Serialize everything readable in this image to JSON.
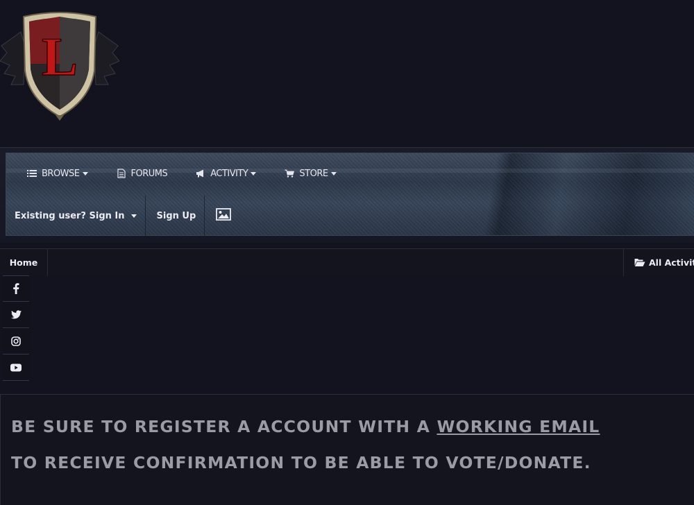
{
  "brand": {
    "logo_letter": "L"
  },
  "primary_nav": {
    "items": [
      {
        "label": "Browse",
        "icon": "list-icon",
        "has_dropdown": true
      },
      {
        "label": "Forums",
        "icon": "document-icon",
        "has_dropdown": false
      },
      {
        "label": "Activity",
        "icon": "bullhorn-icon",
        "has_dropdown": true
      },
      {
        "label": "Store",
        "icon": "cart-icon",
        "has_dropdown": true
      }
    ]
  },
  "user_nav": {
    "sign_in_label": "Existing user? Sign In",
    "sign_up_label": "Sign Up",
    "image_icon": "image-icon"
  },
  "breadcrumb": {
    "home_label": "Home",
    "all_activity_label": "All Activity",
    "all_activity_icon": "folder-open-icon"
  },
  "social": [
    "facebook-icon",
    "twitter-icon",
    "instagram-icon",
    "youtube-icon"
  ],
  "notice": {
    "line1_prefix": "BE SURE TO REGISTER A ACCOUNT WITH A ",
    "line1_link": "WORKING EMAIL",
    "line2": "TO RECEIVE CONFIRMATION TO BE ABLE TO VOTE/DONATE."
  },
  "colors": {
    "background": "#13131f",
    "nav_text": "#e6e6ee",
    "notice_text": "#9a9ba4",
    "logo_red": "#c01818"
  }
}
